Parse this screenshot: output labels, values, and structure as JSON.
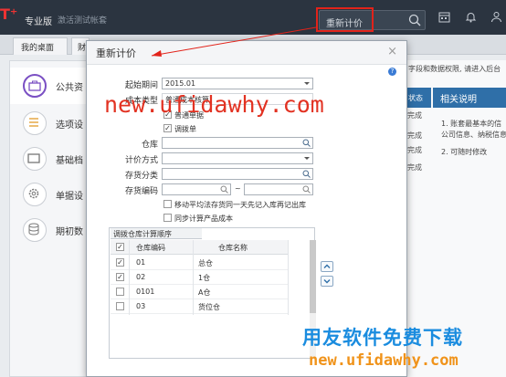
{
  "app": {
    "edition": "专业版",
    "company": "激活测试帐套",
    "search_text": "重新计价",
    "brand_color": "#2b3440",
    "highlight_color": "#e2231a"
  },
  "tabs": [
    {
      "label": "我的桌面"
    },
    {
      "label": "财"
    }
  ],
  "nav": {
    "items": [
      {
        "label": "公共资",
        "icon": "briefcase-icon"
      },
      {
        "label": "选项设",
        "icon": "list-icon"
      },
      {
        "label": "基础档",
        "icon": "folder-icon"
      },
      {
        "label": "单据设",
        "icon": "gear-icon"
      },
      {
        "label": "期初数",
        "icon": "database-icon"
      }
    ]
  },
  "background": {
    "hint_line": "字段和数据权限, 请进入后台",
    "status_header": "状态",
    "finish_labels": [
      "完成",
      "完成",
      "完成",
      "完成"
    ],
    "related_title": "相关说明",
    "related_lines": [
      "1. 账套最基本的信",
      "公司信息、纳税信息",
      "2. 可随时修改"
    ]
  },
  "dialog": {
    "title": "重新计价",
    "close": "×",
    "help": "?",
    "fields": {
      "start_period_label": "起始期间",
      "start_period_value": "2015.01",
      "cost_type_label": "成本类型",
      "cost_type_value": "普通成本核算",
      "chk_normal_label": "普通单据",
      "chk_transfer_label": "调拨单",
      "warehouse_label": "仓库",
      "valuation_label": "计价方式",
      "category_label": "存货分类",
      "code_label": "存货编码",
      "range_sep": "~",
      "chk_moving_label": "移动平均法存货同一天先记入库再记出库",
      "chk_sync_label": "同步计算产品成本"
    },
    "warehouse_order": {
      "title": "调拨仓库计算顺序",
      "columns": [
        "仓库编码",
        "仓库名称"
      ],
      "rows": [
        {
          "checked": true,
          "code": "01",
          "name": "总仓"
        },
        {
          "checked": true,
          "code": "02",
          "name": "1仓"
        },
        {
          "checked": false,
          "code": "0101",
          "name": "A仓"
        },
        {
          "checked": false,
          "code": "03",
          "name": "货位仓"
        }
      ]
    }
  },
  "watermarks": {
    "url_red": "new.ufidawhy.com",
    "cn_blue": "用友软件免费下载",
    "url_orange": "new.ufidawhy.com"
  }
}
